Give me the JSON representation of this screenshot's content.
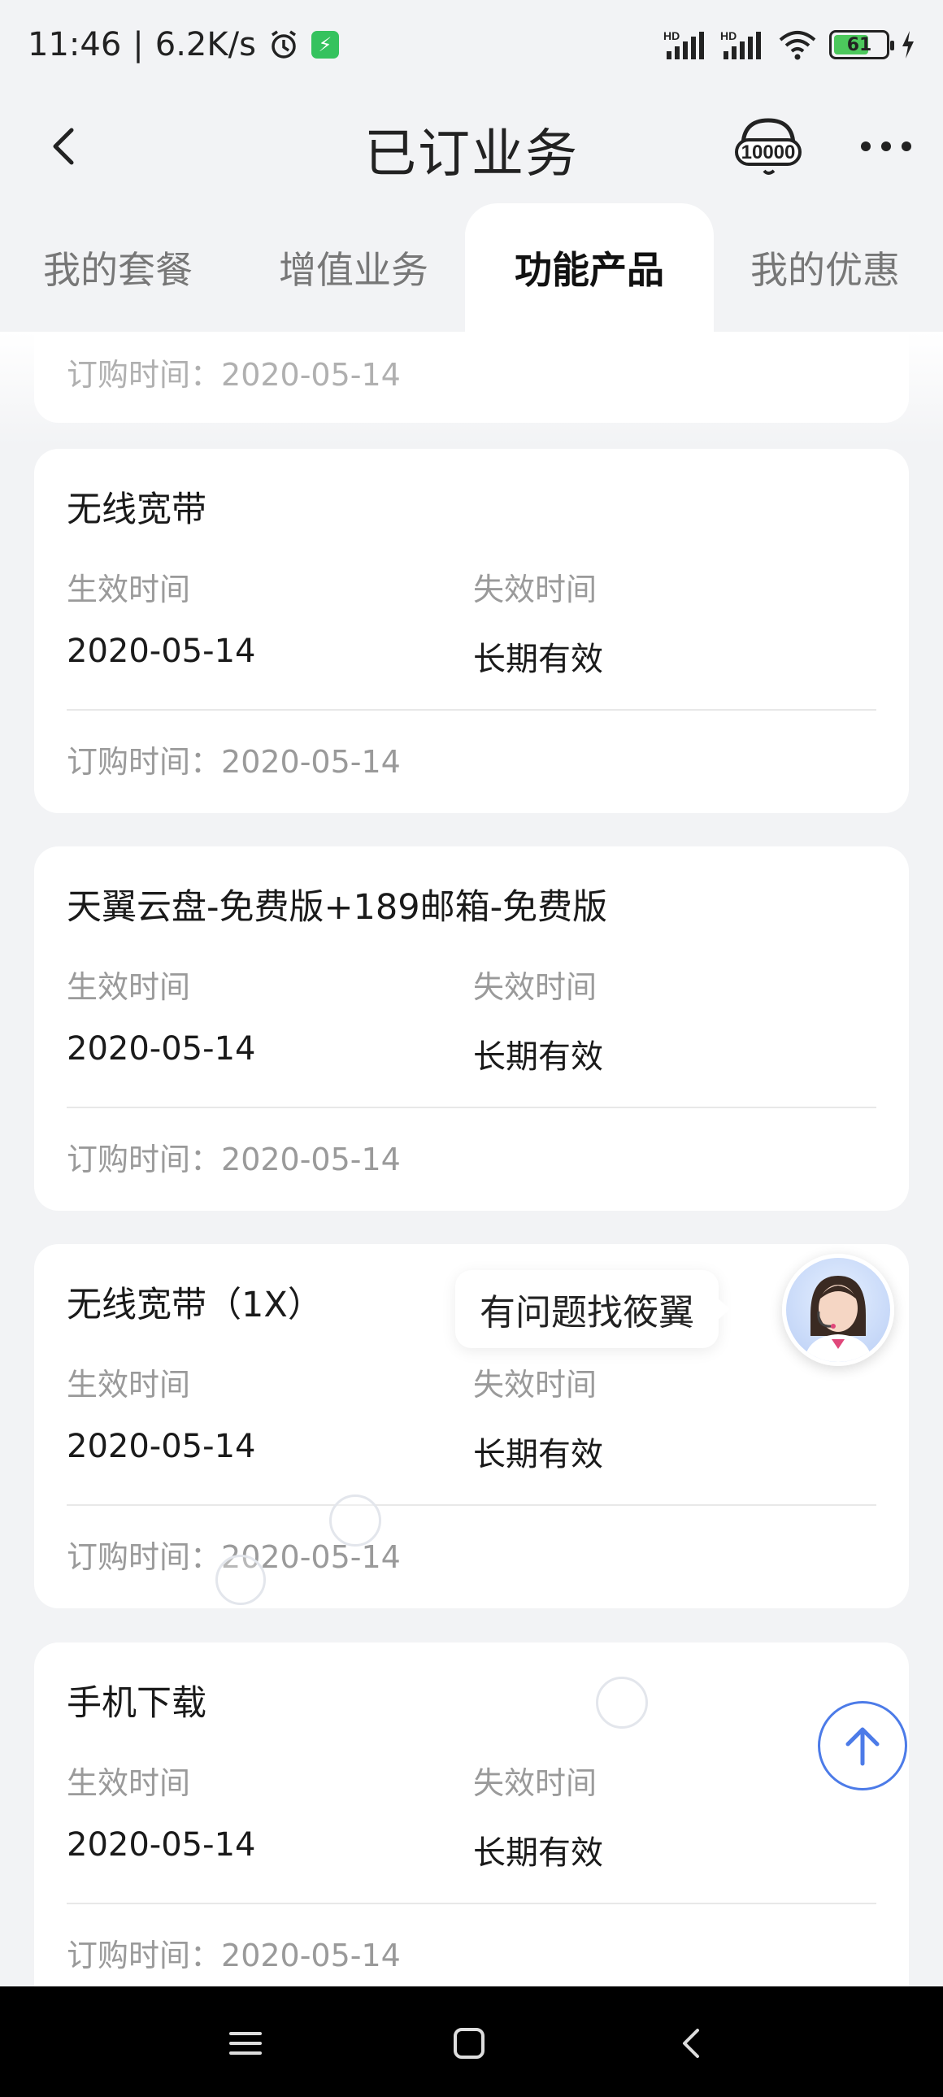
{
  "status_bar": {
    "time": "11:46",
    "separator": "|",
    "net_speed": "6.2K/s",
    "signal1_label": "HD",
    "signal2_label": "HD",
    "battery_level": "61"
  },
  "header": {
    "title": "已订业务",
    "hotline_label": "10000"
  },
  "tabs": [
    {
      "label": "我的套餐",
      "active": false
    },
    {
      "label": "增值业务",
      "active": false
    },
    {
      "label": "功能产品",
      "active": true
    },
    {
      "label": "我的优惠",
      "active": false
    }
  ],
  "partial_card": {
    "order_label": "订购时间：",
    "order_value": "2020-05-14"
  },
  "cards": [
    {
      "title": "无线宽带",
      "effective_label": "生效时间",
      "effective_value": "2020-05-14",
      "expiry_label": "失效时间",
      "expiry_value": "长期有效",
      "order_label": "订购时间：",
      "order_value": "2020-05-14"
    },
    {
      "title": "天翼云盘-免费版+189邮箱-免费版",
      "effective_label": "生效时间",
      "effective_value": "2020-05-14",
      "expiry_label": "失效时间",
      "expiry_value": "长期有效",
      "order_label": "订购时间：",
      "order_value": "2020-05-14"
    },
    {
      "title": "无线宽带（1X）",
      "effective_label": "生效时间",
      "effective_value": "2020-05-14",
      "expiry_label": "失效时间",
      "expiry_value": "长期有效",
      "order_label": "订购时间：",
      "order_value": "2020-05-14"
    },
    {
      "title": "手机下载",
      "effective_label": "生效时间",
      "effective_value": "2020-05-14",
      "expiry_label": "失效时间",
      "expiry_value": "长期有效",
      "order_label": "订购时间：",
      "order_value": "2020-05-14"
    }
  ],
  "assistant": {
    "prompt": "有问题找筱翼"
  },
  "colors": {
    "accent": "#4c7be8",
    "background": "#f2f3f5",
    "card": "#ffffff",
    "muted_text": "#9a9a9a"
  }
}
